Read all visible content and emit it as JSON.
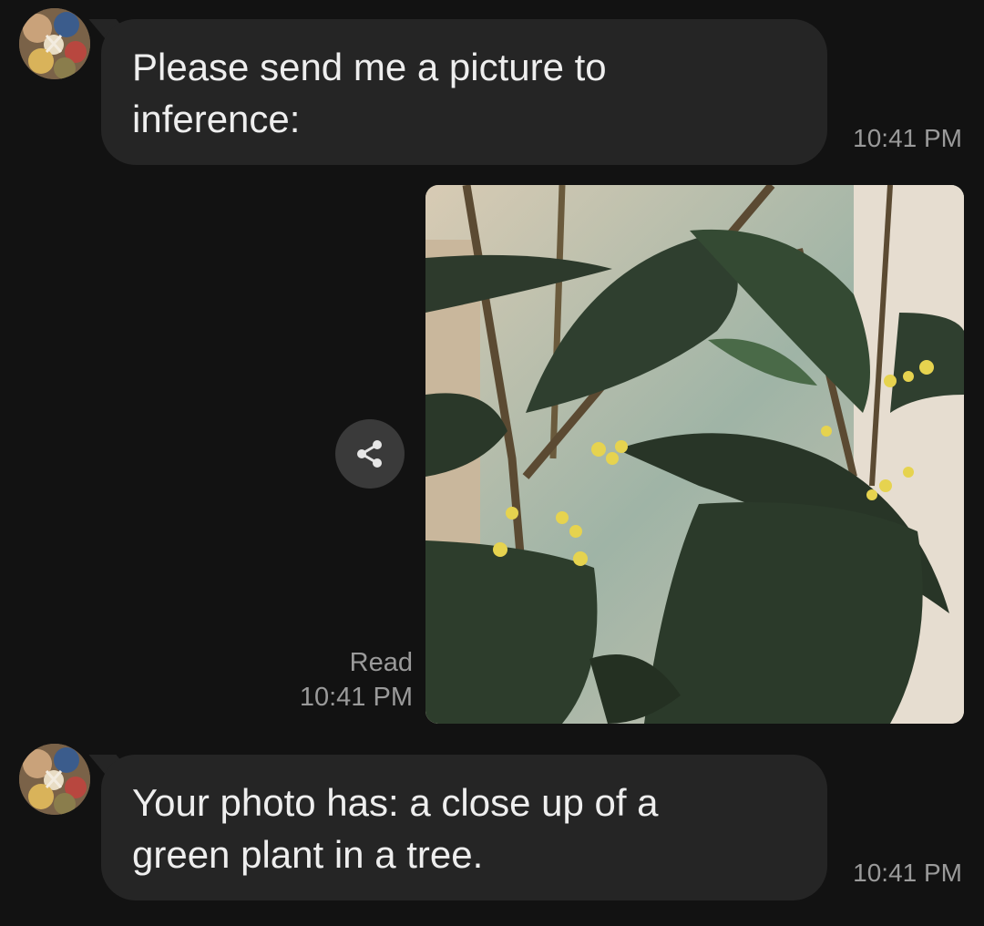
{
  "messages": {
    "first": {
      "text": "Please send me a picture to\ninference:",
      "time": "10:41 PM"
    },
    "photo": {
      "status": "Read",
      "time": "10:41 PM",
      "icon": "share-icon"
    },
    "second": {
      "text": "Your photo has: a close up of a\ngreen plant in a tree.",
      "time": "10:41 PM"
    }
  },
  "colors": {
    "background": "#121212",
    "bubble": "#252525",
    "timestamp": "#9a9a9a",
    "share_button": "#3a3a3a"
  }
}
